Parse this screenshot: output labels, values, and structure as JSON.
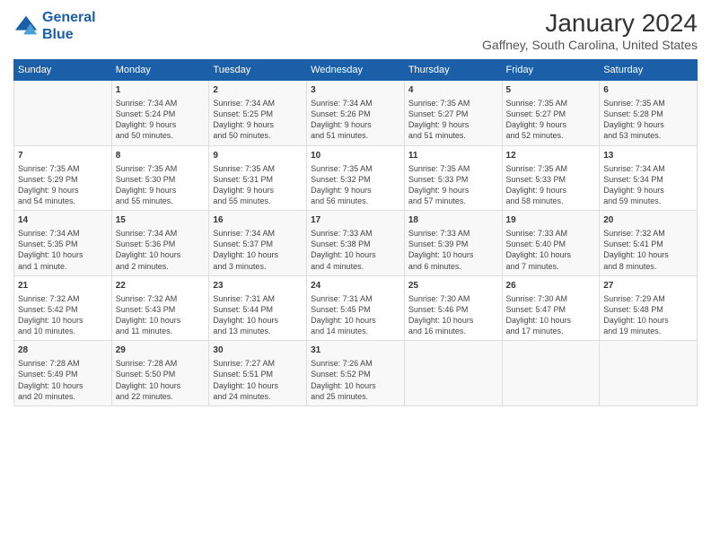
{
  "logo": {
    "line1": "General",
    "line2": "Blue"
  },
  "title": "January 2024",
  "subtitle": "Gaffney, South Carolina, United States",
  "header_row": [
    "Sunday",
    "Monday",
    "Tuesday",
    "Wednesday",
    "Thursday",
    "Friday",
    "Saturday"
  ],
  "weeks": [
    [
      {
        "day": "",
        "content": ""
      },
      {
        "day": "1",
        "content": "Sunrise: 7:34 AM\nSunset: 5:24 PM\nDaylight: 9 hours\nand 50 minutes."
      },
      {
        "day": "2",
        "content": "Sunrise: 7:34 AM\nSunset: 5:25 PM\nDaylight: 9 hours\nand 50 minutes."
      },
      {
        "day": "3",
        "content": "Sunrise: 7:34 AM\nSunset: 5:26 PM\nDaylight: 9 hours\nand 51 minutes."
      },
      {
        "day": "4",
        "content": "Sunrise: 7:35 AM\nSunset: 5:27 PM\nDaylight: 9 hours\nand 51 minutes."
      },
      {
        "day": "5",
        "content": "Sunrise: 7:35 AM\nSunset: 5:27 PM\nDaylight: 9 hours\nand 52 minutes."
      },
      {
        "day": "6",
        "content": "Sunrise: 7:35 AM\nSunset: 5:28 PM\nDaylight: 9 hours\nand 53 minutes."
      }
    ],
    [
      {
        "day": "7",
        "content": "Sunrise: 7:35 AM\nSunset: 5:29 PM\nDaylight: 9 hours\nand 54 minutes."
      },
      {
        "day": "8",
        "content": "Sunrise: 7:35 AM\nSunset: 5:30 PM\nDaylight: 9 hours\nand 55 minutes."
      },
      {
        "day": "9",
        "content": "Sunrise: 7:35 AM\nSunset: 5:31 PM\nDaylight: 9 hours\nand 55 minutes."
      },
      {
        "day": "10",
        "content": "Sunrise: 7:35 AM\nSunset: 5:32 PM\nDaylight: 9 hours\nand 56 minutes."
      },
      {
        "day": "11",
        "content": "Sunrise: 7:35 AM\nSunset: 5:33 PM\nDaylight: 9 hours\nand 57 minutes."
      },
      {
        "day": "12",
        "content": "Sunrise: 7:35 AM\nSunset: 5:33 PM\nDaylight: 9 hours\nand 58 minutes."
      },
      {
        "day": "13",
        "content": "Sunrise: 7:34 AM\nSunset: 5:34 PM\nDaylight: 9 hours\nand 59 minutes."
      }
    ],
    [
      {
        "day": "14",
        "content": "Sunrise: 7:34 AM\nSunset: 5:35 PM\nDaylight: 10 hours\nand 1 minute."
      },
      {
        "day": "15",
        "content": "Sunrise: 7:34 AM\nSunset: 5:36 PM\nDaylight: 10 hours\nand 2 minutes."
      },
      {
        "day": "16",
        "content": "Sunrise: 7:34 AM\nSunset: 5:37 PM\nDaylight: 10 hours\nand 3 minutes."
      },
      {
        "day": "17",
        "content": "Sunrise: 7:33 AM\nSunset: 5:38 PM\nDaylight: 10 hours\nand 4 minutes."
      },
      {
        "day": "18",
        "content": "Sunrise: 7:33 AM\nSunset: 5:39 PM\nDaylight: 10 hours\nand 6 minutes."
      },
      {
        "day": "19",
        "content": "Sunrise: 7:33 AM\nSunset: 5:40 PM\nDaylight: 10 hours\nand 7 minutes."
      },
      {
        "day": "20",
        "content": "Sunrise: 7:32 AM\nSunset: 5:41 PM\nDaylight: 10 hours\nand 8 minutes."
      }
    ],
    [
      {
        "day": "21",
        "content": "Sunrise: 7:32 AM\nSunset: 5:42 PM\nDaylight: 10 hours\nand 10 minutes."
      },
      {
        "day": "22",
        "content": "Sunrise: 7:32 AM\nSunset: 5:43 PM\nDaylight: 10 hours\nand 11 minutes."
      },
      {
        "day": "23",
        "content": "Sunrise: 7:31 AM\nSunset: 5:44 PM\nDaylight: 10 hours\nand 13 minutes."
      },
      {
        "day": "24",
        "content": "Sunrise: 7:31 AM\nSunset: 5:45 PM\nDaylight: 10 hours\nand 14 minutes."
      },
      {
        "day": "25",
        "content": "Sunrise: 7:30 AM\nSunset: 5:46 PM\nDaylight: 10 hours\nand 16 minutes."
      },
      {
        "day": "26",
        "content": "Sunrise: 7:30 AM\nSunset: 5:47 PM\nDaylight: 10 hours\nand 17 minutes."
      },
      {
        "day": "27",
        "content": "Sunrise: 7:29 AM\nSunset: 5:48 PM\nDaylight: 10 hours\nand 19 minutes."
      }
    ],
    [
      {
        "day": "28",
        "content": "Sunrise: 7:28 AM\nSunset: 5:49 PM\nDaylight: 10 hours\nand 20 minutes."
      },
      {
        "day": "29",
        "content": "Sunrise: 7:28 AM\nSunset: 5:50 PM\nDaylight: 10 hours\nand 22 minutes."
      },
      {
        "day": "30",
        "content": "Sunrise: 7:27 AM\nSunset: 5:51 PM\nDaylight: 10 hours\nand 24 minutes."
      },
      {
        "day": "31",
        "content": "Sunrise: 7:26 AM\nSunset: 5:52 PM\nDaylight: 10 hours\nand 25 minutes."
      },
      {
        "day": "",
        "content": ""
      },
      {
        "day": "",
        "content": ""
      },
      {
        "day": "",
        "content": ""
      }
    ]
  ]
}
